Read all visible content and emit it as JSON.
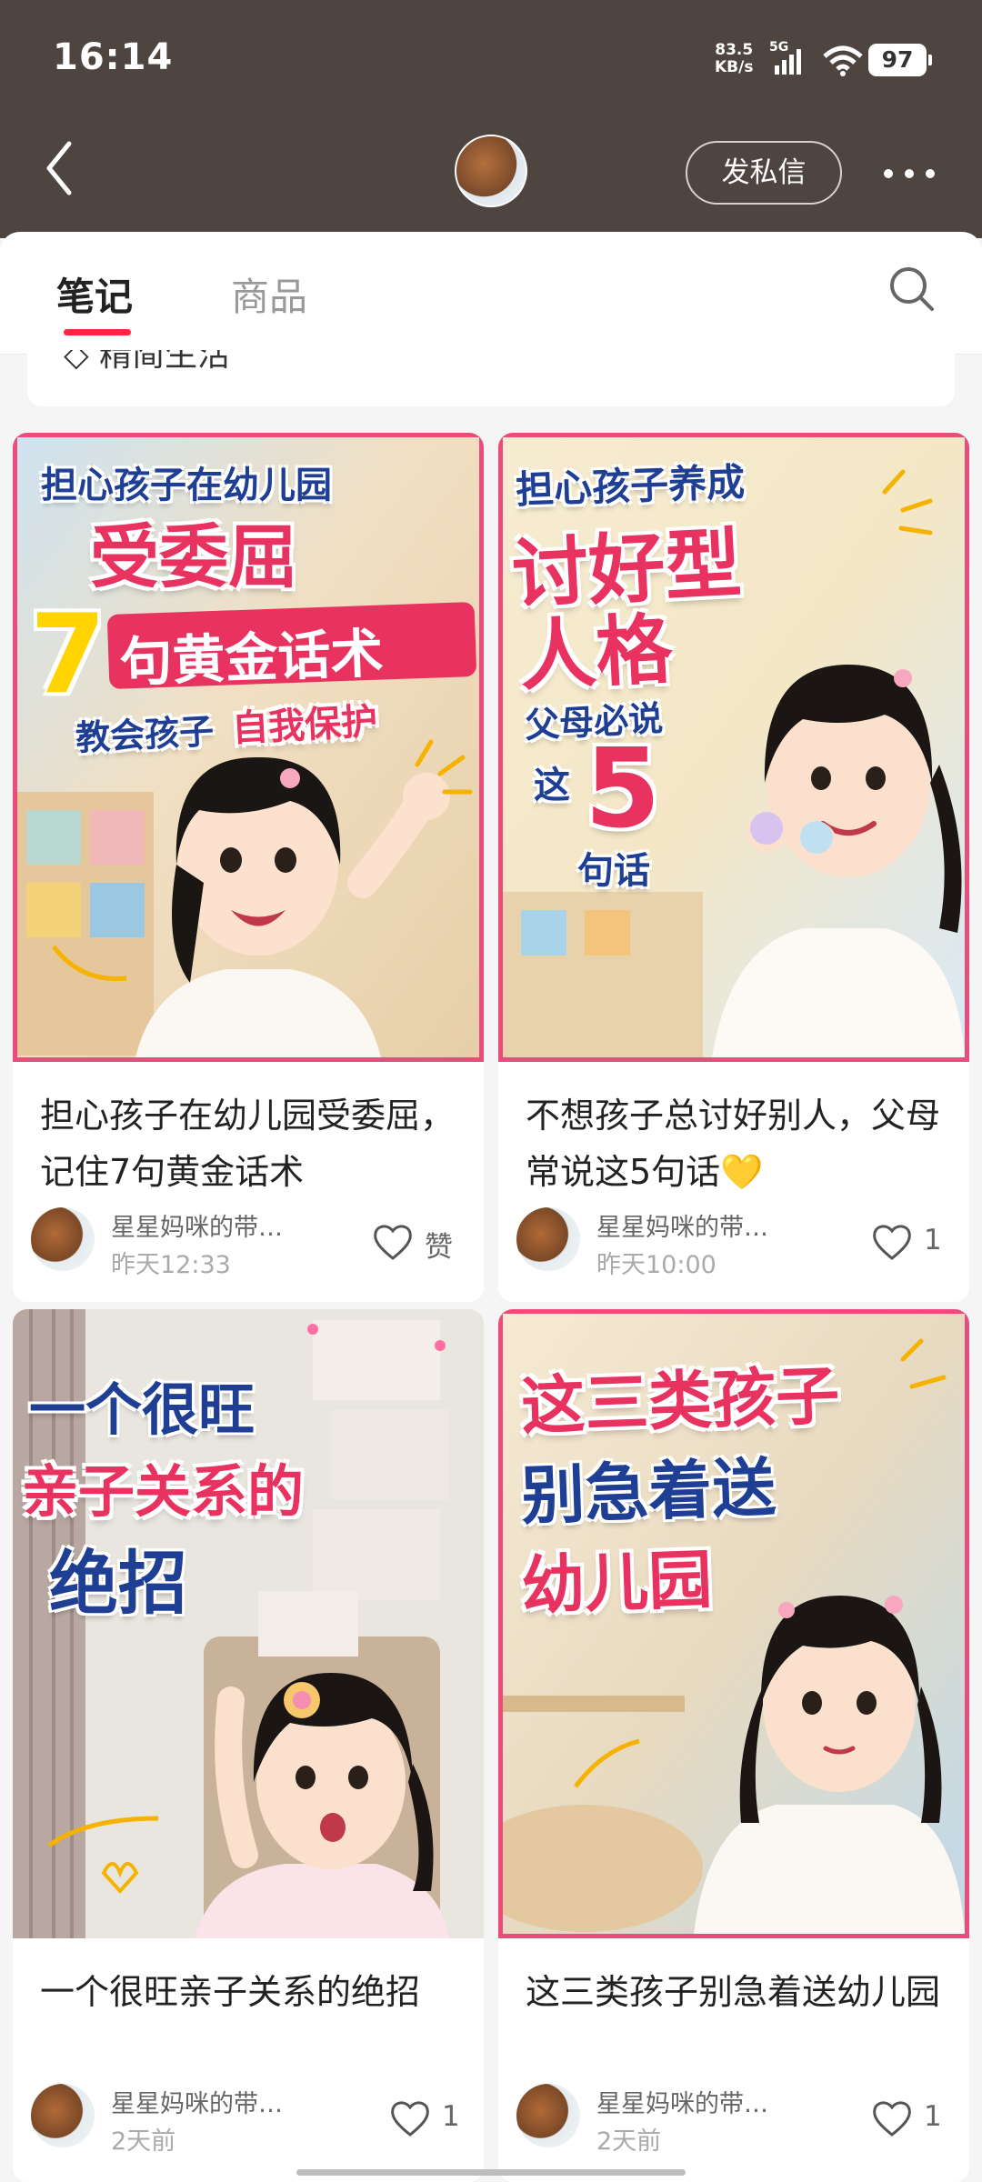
{
  "status_bar": {
    "time": "16:14",
    "net_speed_value": "83.5",
    "net_speed_unit": "KB/s",
    "network": "5G",
    "battery": "97"
  },
  "header": {
    "dm_button": "发私信"
  },
  "tabs": {
    "notes": "笔记",
    "goods": "商品"
  },
  "collapsed_card_text": "精简生活",
  "notes": [
    {
      "cover_lines": [
        "担心孩子在幼儿园",
        "受委屈",
        "7",
        "句黄金话术",
        "教会孩子",
        "自我保护"
      ],
      "title": "担心孩子在幼儿园受委屈，记住7句黄金话术",
      "author": "星星妈咪的带…",
      "time": "昨天12:33",
      "likes": "赞"
    },
    {
      "cover_lines": [
        "担心孩子养成",
        "讨好型",
        "人格",
        "父母必说",
        "这",
        "5",
        "句话"
      ],
      "title": "不想孩子总讨好别人，父母常说这5句话💛",
      "author": "星星妈咪的带…",
      "time": "昨天10:00",
      "likes": "1"
    },
    {
      "cover_lines": [
        "一个很旺",
        "亲子关系的",
        "绝招"
      ],
      "title": "一个很旺亲子关系的绝招",
      "author": "星星妈咪的带…",
      "time": "2天前",
      "likes": "1"
    },
    {
      "cover_lines": [
        "这三类孩子",
        "别急着送",
        "幼儿园"
      ],
      "title": "这三类孩子别急着送幼儿园",
      "author": "星星妈咪的带…",
      "time": "2天前",
      "likes": "1"
    }
  ],
  "colors": {
    "header_bg": "#4e4440",
    "accent": "#ff2442",
    "cover_frame": "#ec4c7c"
  }
}
